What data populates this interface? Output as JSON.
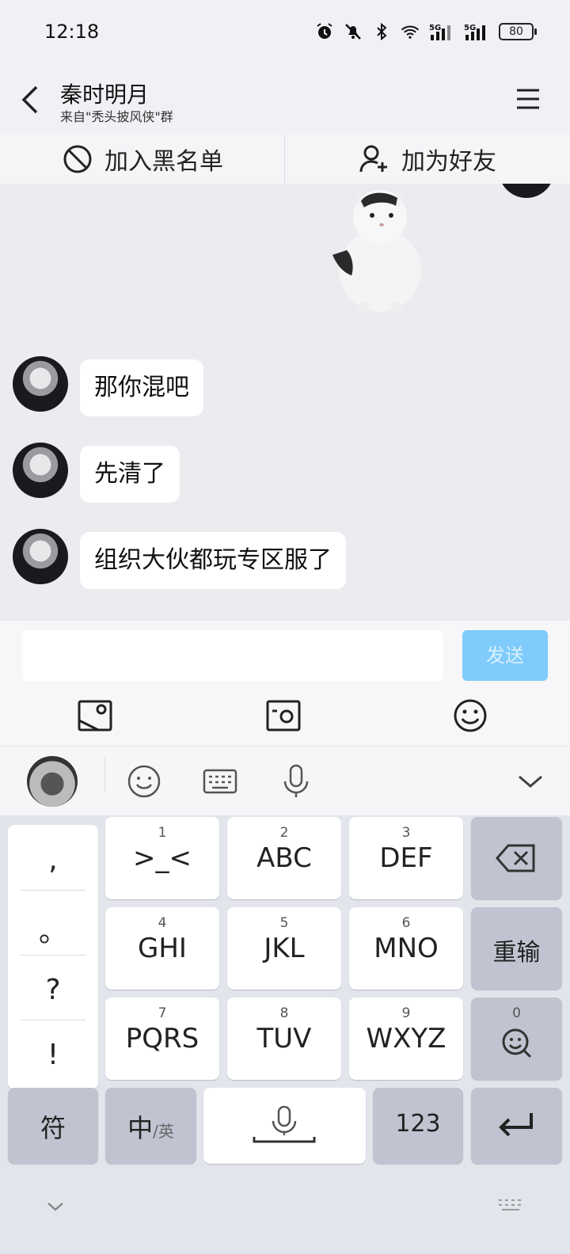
{
  "status_bar": {
    "time": "12:18",
    "battery": "80",
    "icons": [
      "alarm-icon",
      "mute-icon",
      "bluetooth-icon",
      "wifi-icon",
      "signal-5g-icon",
      "signal-5g-icon",
      "battery-icon"
    ]
  },
  "header": {
    "title": "秦时明月",
    "subtitle": "来自\"秃头披风侠\"群",
    "back_icon": "chevron-left-icon",
    "menu_icon": "menu-icon"
  },
  "actions": {
    "block": "加入黑名单",
    "add_friend": "加为好友"
  },
  "messages": [
    {
      "text": "那你混吧"
    },
    {
      "text": "先清了"
    },
    {
      "text": "组织大伙都玩专区服了"
    }
  ],
  "input": {
    "placeholder": "",
    "send": "发送"
  },
  "keyboard": {
    "punctuation": [
      ",",
      "。",
      "?",
      "!"
    ],
    "keys": [
      {
        "num": "1",
        "label": ">_<"
      },
      {
        "num": "2",
        "label": "ABC"
      },
      {
        "num": "3",
        "label": "DEF"
      },
      {
        "num": "4",
        "label": "GHI"
      },
      {
        "num": "5",
        "label": "JKL"
      },
      {
        "num": "6",
        "label": "MNO"
      },
      {
        "num": "7",
        "label": "PQRS"
      },
      {
        "num": "8",
        "label": "TUV"
      },
      {
        "num": "9",
        "label": "WXYZ"
      }
    ],
    "reenter": "重输",
    "search_num": "0",
    "symbol": "符",
    "lang_main": "中",
    "lang_alt": "/英",
    "numeric": "123"
  },
  "colors": {
    "send_button": "#7fcbfb",
    "chat_bg": "#ebebf0",
    "dark_key": "#bfc4d0"
  }
}
